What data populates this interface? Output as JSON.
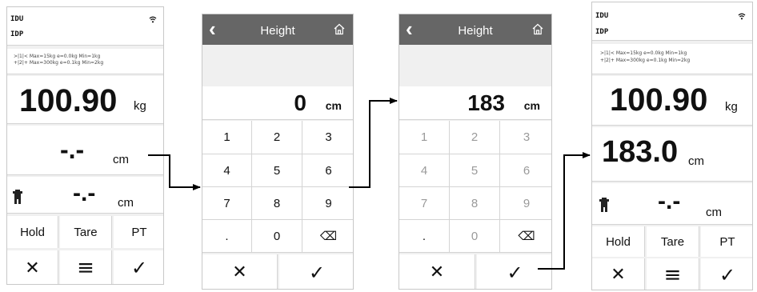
{
  "screen1": {
    "status_line1": "IDU",
    "status_line2": "IDP",
    "scale_line1": ">|1|< Max=15kg e=0.0kg Min=1kg",
    "scale_line2": "+|2|+ Max=300kg e=0.1kg Min=2kg",
    "weight_value": "100.90",
    "weight_unit": "kg",
    "height_value": "-.-",
    "height_unit": "cm",
    "bmi_value": "-.-",
    "bmi_unit": "cm",
    "softkeys": [
      "Hold",
      "Tare",
      "PT"
    ],
    "nav": {
      "cancel": "✕",
      "menu": "≡",
      "ok": "✓"
    }
  },
  "screen2": {
    "title": "Height",
    "back": "‹",
    "home_icon": "home-icon",
    "display_value": "0",
    "display_unit": "cm",
    "keys": [
      "1",
      "2",
      "3",
      "4",
      "5",
      "6",
      "7",
      "8",
      "9",
      ".",
      "0",
      "⌫"
    ],
    "nav": {
      "cancel": "✕",
      "ok": "✓"
    }
  },
  "screen3": {
    "title": "Height",
    "back": "‹",
    "home_icon": "home-icon",
    "display_value": "183",
    "display_unit": "cm",
    "keys": [
      "1",
      "2",
      "3",
      "4",
      "5",
      "6",
      "7",
      "8",
      "9",
      ".",
      "0",
      "⌫"
    ],
    "nav": {
      "cancel": "✕",
      "ok": "✓"
    }
  },
  "screen4": {
    "status_line1": "IDU",
    "status_line2": "IDP",
    "scale_line1": ">|1|< Max=15kg e=0.0kg Min=1kg",
    "scale_line2": "+|2|+ Max=300kg e=0.1kg Min=2kg",
    "weight_value": "100.90",
    "weight_unit": "kg",
    "height_value": "183.0",
    "height_unit": "cm",
    "bmi_value": "-.-",
    "bmi_unit": "cm",
    "softkeys": [
      "Hold",
      "Tare",
      "PT"
    ],
    "nav": {
      "cancel": "✕",
      "menu": "≡",
      "ok": "✓"
    }
  },
  "colors": {
    "header": "#666666",
    "panel": "#f0f0f0",
    "divider": "#d4d4d4",
    "arrow": "#000000"
  }
}
